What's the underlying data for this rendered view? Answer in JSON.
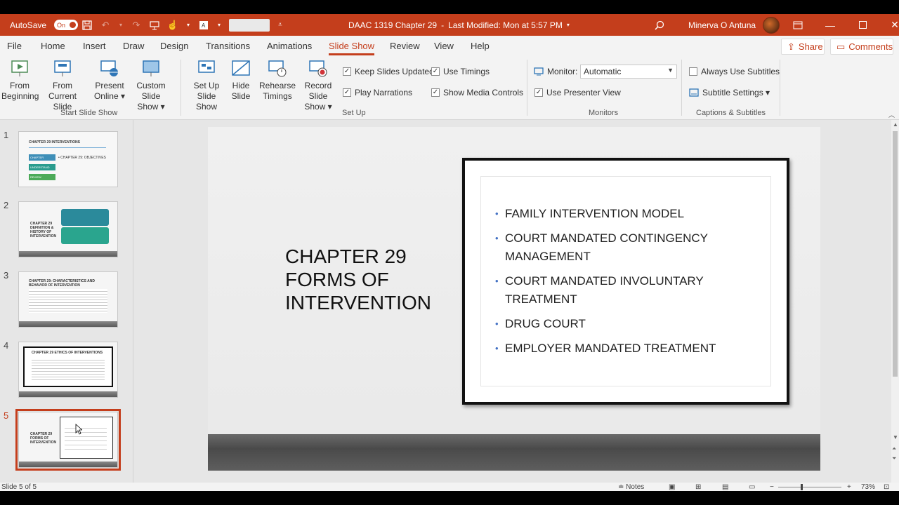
{
  "titlebar": {
    "autosave_label": "AutoSave",
    "autosave_state": "On",
    "document_title": "DAAC 1319 Chapter 29",
    "separator": "-",
    "last_modified": "Last Modified: Mon at 5:57 PM",
    "user_name": "Minerva O Antuna"
  },
  "menu": {
    "items": [
      "File",
      "Home",
      "Insert",
      "Draw",
      "Design",
      "Transitions",
      "Animations",
      "Slide Show",
      "Review",
      "View",
      "Help"
    ],
    "active": "Slide Show",
    "share_label": "Share",
    "comments_label": "Comments"
  },
  "ribbon": {
    "start": {
      "from_beginning": [
        "From",
        "Beginning"
      ],
      "from_current": [
        "From",
        "Current Slide"
      ],
      "present_online": [
        "Present",
        "Online ▾"
      ],
      "custom_show": [
        "Custom Slide",
        "Show ▾"
      ],
      "group_label": "Start Slide Show"
    },
    "setup": {
      "setup_show": [
        "Set Up",
        "Slide Show"
      ],
      "hide_slide": [
        "Hide",
        "Slide"
      ],
      "rehearse": [
        "Rehearse",
        "Timings"
      ],
      "record": [
        "Record Slide",
        "Show ▾"
      ],
      "keep_updated": "Keep Slides Updated",
      "play_narrations": "Play Narrations",
      "use_timings": "Use Timings",
      "show_media": "Show Media Controls",
      "group_label": "Set Up"
    },
    "monitors": {
      "monitor_label": "Monitor:",
      "monitor_value": "Automatic",
      "presenter_view": "Use Presenter View",
      "group_label": "Monitors"
    },
    "captions": {
      "always_subtitles": "Always Use Subtitles",
      "subtitle_settings": "Subtitle Settings ▾",
      "group_label": "Captions & Subtitles"
    }
  },
  "thumbnails": {
    "numbers": [
      "1",
      "2",
      "3",
      "4",
      "5"
    ],
    "selected": 5,
    "t1": {
      "title": "CHAPTER 29   INTERVENTIONS",
      "chips": [
        "CHAPTER",
        "UNDERSTAND",
        "REVIEW"
      ],
      "sub": "• CHAPTER 29: OBJECTIVES"
    },
    "t2": {
      "title": "CHAPTER 29 DEFINITION & HISTORY OF INTERVENTION"
    },
    "t3": {
      "title": "CHAPTER 29: CHARACTERISTICS AND BEHAVIOR OF INTERVENTION"
    },
    "t4": {
      "title": "CHAPTER 29  ETHICS OF INTERVENTIONS"
    },
    "t5": {
      "title": "CHAPTER 29 FORMS OF INTERVENTION"
    }
  },
  "slide": {
    "title": "CHAPTER 29 FORMS OF INTERVENTION",
    "bullets": [
      "FAMILY INTERVENTION MODEL",
      "COURT MANDATED CONTINGENCY MANAGEMENT",
      "COURT MANDATED INVOLUNTARY TREATMENT",
      "DRUG COURT",
      "EMPLOYER MANDATED TREATMENT"
    ]
  },
  "statusbar": {
    "slide_info": "Slide 5 of 5",
    "notes": "Notes",
    "zoom": "73%"
  },
  "colors": {
    "brand": "#c43e1c",
    "bullet": "#4472c4",
    "ribbon_bg": "#f3f3f3"
  }
}
